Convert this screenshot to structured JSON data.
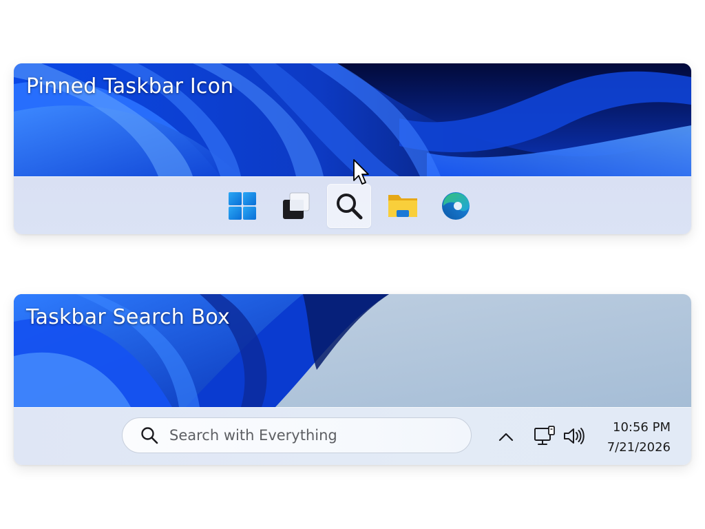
{
  "panels": [
    {
      "title": "Pinned Taskbar Icon",
      "taskbar_icons": [
        {
          "name": "windows-start-icon",
          "label": ""
        },
        {
          "name": "task-view-icon",
          "label": ""
        },
        {
          "name": "search-icon",
          "label": "",
          "state": "hovered"
        },
        {
          "name": "file-explorer-icon",
          "label": ""
        },
        {
          "name": "edge-browser-icon",
          "label": ""
        }
      ]
    },
    {
      "title": "Taskbar Search Box",
      "search": {
        "placeholder": "Search with Everything"
      },
      "tray": {
        "icons": [
          "chevron-up-icon",
          "network-icon",
          "volume-icon"
        ],
        "time": "10:56 PM",
        "date": "7/21/2026"
      }
    }
  ],
  "colors": {
    "accent_blue": "#1a5cff",
    "taskbar_bg": "#dae1f4",
    "start_blue": "#1f8fe8",
    "folder_yellow": "#f7c530",
    "edge_teal": "#35c07a"
  }
}
